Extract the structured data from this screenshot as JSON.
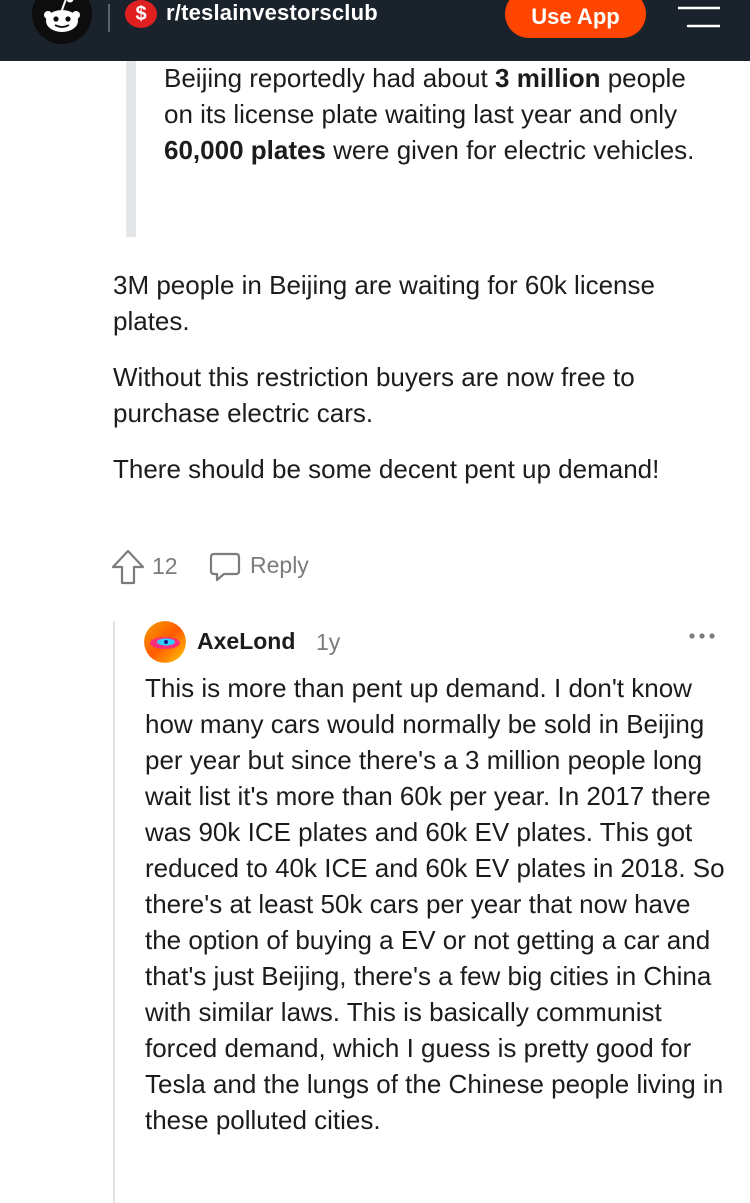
{
  "header": {
    "subreddit": "r/teslainvestorsclub",
    "subreddit_icon": "$",
    "cta_label": "Use App",
    "brand_color": "#ff4500",
    "bar_color": "#1a222c"
  },
  "comment": {
    "quote_prefix": "Beijing reportedly had about ",
    "quote_bold1": "3 million",
    "quote_mid": " people on its license plate waiting last year and only ",
    "quote_bold2": "60,000 plates",
    "quote_suffix": " were given for electric vehicles.",
    "paragraphs": [
      "3M people in Beijing are waiting for 60k license plates.",
      "Without this restriction buyers are now free to purchase electric cars.",
      "There should be some decent pent up demand!"
    ],
    "votes": "12",
    "reply_label": "Reply"
  },
  "reply": {
    "username": "AxeLond",
    "timestamp": "1y",
    "more_icon": "ellipsis-icon",
    "text": "This is more than pent up demand. I don't know how many cars would normally be sold in Beijing per year but since there's a 3 million people long wait list it's more than 60k per year. In 2017 there was 90k ICE plates and 60k EV plates. This got reduced to 40k ICE and 60k EV plates in 2018. So there's at least 50k cars per year that now have the option of buying a EV or not getting a car and that's just Beijing, there's a few big cities in China with similar laws. This is basically communist forced demand, which I guess is pretty good for Tesla and the lungs of the Chinese people living in these polluted cities."
  }
}
